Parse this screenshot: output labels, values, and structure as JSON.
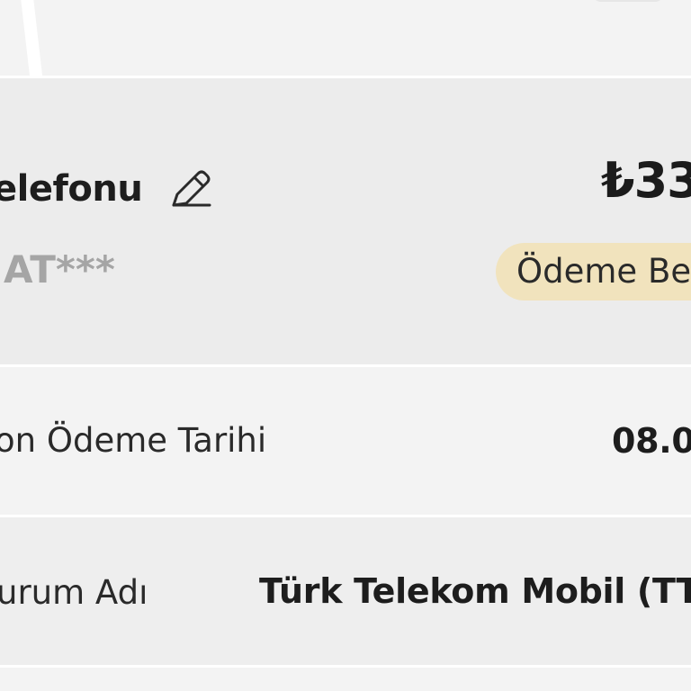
{
  "account": {
    "title": "elefonu",
    "masked_number": "AT***",
    "amount": "₺33",
    "status_badge": "Ödeme Be"
  },
  "details": [
    {
      "label": "on Ödeme Tarihi",
      "value": "08.0"
    },
    {
      "label": "urum Adı",
      "value": "Türk Telekom Mobil (TT"
    }
  ],
  "icons": {
    "edit": "pencil-icon"
  },
  "colors": {
    "badge_background": "#f1e3bd",
    "masked_text": "#a5a5a5"
  }
}
